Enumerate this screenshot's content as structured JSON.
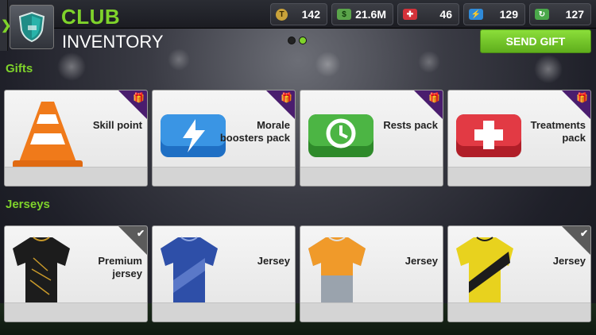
{
  "header": {
    "title": "CLUB",
    "subtitle": "INVENTORY",
    "send_gift_label": "SEND GIFT"
  },
  "currencies": [
    {
      "icon": "token-icon",
      "value": "142",
      "color": "#c9a23a"
    },
    {
      "icon": "cash-icon",
      "value": "21.6M",
      "color": "#5aa44a"
    },
    {
      "icon": "treatment-icon",
      "value": "46",
      "color": "#d4323a"
    },
    {
      "icon": "energy-icon",
      "value": "129",
      "color": "#2f8ad8"
    },
    {
      "icon": "rest-icon",
      "value": "127",
      "color": "#4aa84a"
    }
  ],
  "pager": {
    "pages": 2,
    "active": 2
  },
  "sections": {
    "gifts": {
      "title": "Gifts",
      "items": [
        {
          "name": "Skill point",
          "icon": "cone-icon"
        },
        {
          "name": "Morale boosters pack",
          "icon": "lightning-icon"
        },
        {
          "name": "Rests pack",
          "icon": "clock-icon"
        },
        {
          "name": "Treatments pack",
          "icon": "cross-icon"
        }
      ]
    },
    "jerseys": {
      "title": "Jerseys",
      "items": [
        {
          "name": "Premium jersey",
          "selected": true
        },
        {
          "name": "Jersey",
          "selected": false
        },
        {
          "name": "Jersey",
          "selected": false
        },
        {
          "name": "Jersey",
          "selected": true
        }
      ]
    }
  }
}
